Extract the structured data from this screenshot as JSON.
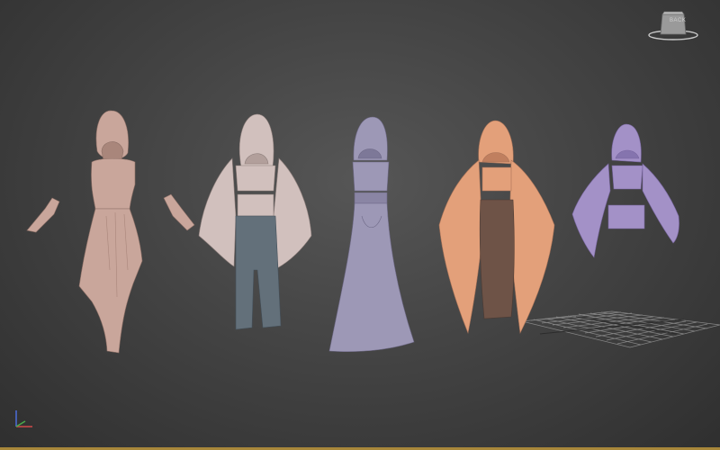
{
  "viewport": {
    "background": "#474747",
    "frame_accent": "#a8873a"
  },
  "viewcube": {
    "label": "BACK",
    "icon": "viewcube-icon"
  },
  "axis_gizmo": {
    "x_color": "#d04a4a",
    "y_color": "#4aaa4a",
    "z_color": "#4a6ad0",
    "icon": "axis-gizmo-icon"
  },
  "models": [
    {
      "name": "hooded-asymmetric-dress",
      "color": "#c9a69b"
    },
    {
      "name": "hooded-cape-top-and-pants",
      "top_color": "#d1c0bd",
      "pants_color": "#63707a"
    },
    {
      "name": "hooded-long-gown",
      "color": "#9d98b6"
    },
    {
      "name": "hooded-wide-sleeve-top-and-skirt",
      "top_color": "#e3a07a",
      "skirt_color": "#6e5347"
    },
    {
      "name": "hooded-crop-top-with-bell-sleeves",
      "color": "#a391c7"
    }
  ],
  "grid_plane": {
    "color": "#8e8e8e"
  }
}
